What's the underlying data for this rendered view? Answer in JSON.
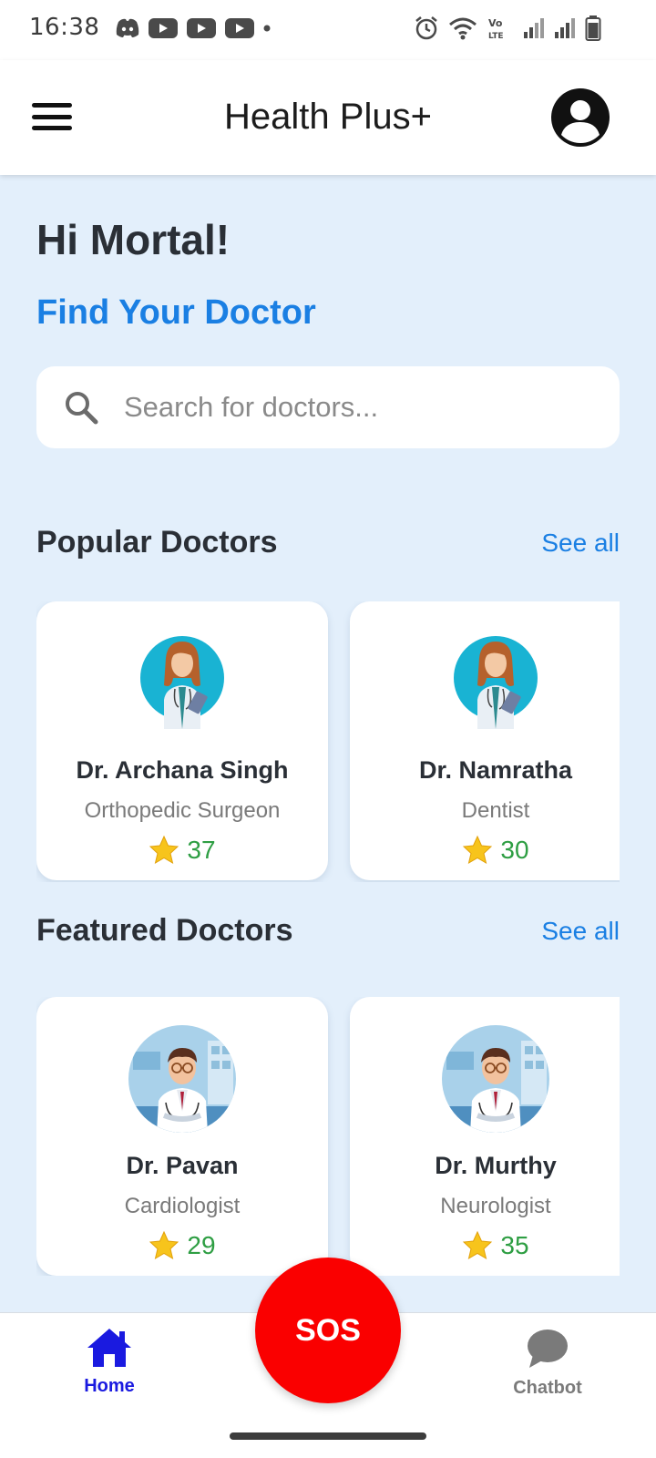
{
  "status_bar": {
    "time": "16:38",
    "left_icons": [
      "discord-icon",
      "youtube-icon",
      "youtube-icon",
      "youtube-icon",
      "dot-icon"
    ],
    "right_icons": [
      "alarm-icon",
      "wifi-icon",
      "volte-icon",
      "signal-icon",
      "signal-icon",
      "battery-icon"
    ],
    "volte_text": "Vo LTE"
  },
  "app_bar": {
    "title": "Health Plus+",
    "menu_icon": "hamburger-menu-icon",
    "profile_icon": "account-circle-icon"
  },
  "main": {
    "greeting": "Hi Mortal!",
    "subheading": "Find Your Doctor",
    "search": {
      "placeholder": "Search for doctors...",
      "value": ""
    }
  },
  "popular": {
    "title": "Popular Doctors",
    "see_all": "See all",
    "doctors": [
      {
        "name": "Dr. Archana Singh",
        "specialty": "Orthopedic Surgeon",
        "rating": "37",
        "avatar": "female-doctor-avatar"
      },
      {
        "name": "Dr. Namratha",
        "specialty": "Dentist",
        "rating": "30",
        "avatar": "female-doctor-avatar"
      }
    ]
  },
  "featured": {
    "title": "Featured Doctors",
    "see_all": "See all",
    "doctors": [
      {
        "name": "Dr. Pavan",
        "specialty": "Cardiologist",
        "rating": "29",
        "avatar": "male-doctor-avatar"
      },
      {
        "name": "Dr. Murthy",
        "specialty": "Neurologist",
        "rating": "35",
        "avatar": "male-doctor-avatar"
      }
    ]
  },
  "bottom_nav": {
    "home_label": "Home",
    "chatbot_label": "Chatbot",
    "sos_label": "SOS",
    "active": "Home"
  },
  "colors": {
    "accent": "#1a7fe3",
    "background": "#e3effb",
    "sos": "#fa0000",
    "rating": "#2e9e43",
    "nav_active": "#1a1ae0"
  }
}
